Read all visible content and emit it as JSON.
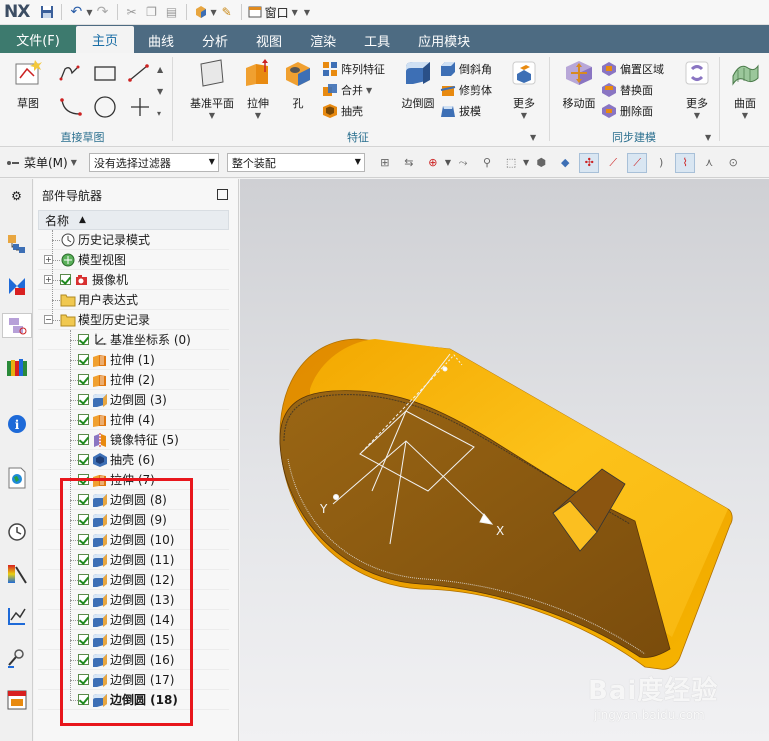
{
  "app": {
    "logo": "NX",
    "window_menu": "窗口"
  },
  "ribbon_tabs": {
    "file": "文件(F)",
    "items": [
      "主页",
      "曲线",
      "分析",
      "视图",
      "渲染",
      "工具",
      "应用模块"
    ]
  },
  "ribbon": {
    "sketch": {
      "label": "草图",
      "group": "直接草图"
    },
    "feature": {
      "group": "特征",
      "datum_plane": "基准平面",
      "extrude": "拉伸",
      "hole": "孔",
      "pattern": "阵列特征",
      "unite": "合并",
      "shell": "抽壳",
      "edge_blend": "边倒圆",
      "chamfer": "倒斜角",
      "trim_body": "修剪体",
      "draft": "拔模",
      "more": "更多"
    },
    "sync": {
      "group": "同步建模",
      "move_face": "移动面",
      "offset_region": "偏置区域",
      "replace_face": "替换面",
      "delete_face": "删除面",
      "more": "更多"
    },
    "surface": {
      "label": "曲面"
    }
  },
  "cmdbar": {
    "menu": "菜单(M)",
    "filter": "没有选择过滤器",
    "assembly": "整个装配"
  },
  "navigator": {
    "title": "部件导航器",
    "column": "名称",
    "items": [
      {
        "label": "历史记录模式",
        "level": 0,
        "icon": "clock-icon",
        "expander": false,
        "check": false
      },
      {
        "label": "模型视图",
        "level": 0,
        "icon": "model-view-icon",
        "expander": true,
        "check": false
      },
      {
        "label": "摄像机",
        "level": 0,
        "icon": "camera-icon",
        "expander": true,
        "check": true
      },
      {
        "label": "用户表达式",
        "level": 0,
        "icon": "folder-icon",
        "expander": false,
        "check": false
      },
      {
        "label": "模型历史记录",
        "level": 0,
        "icon": "folder-icon",
        "expander": "minus",
        "check": false
      },
      {
        "label": "基准坐标系 (0)",
        "level": 1,
        "icon": "datum-csys-icon",
        "check": true
      },
      {
        "label": "拉伸 (1)",
        "level": 1,
        "icon": "extrude-icon",
        "check": true
      },
      {
        "label": "拉伸 (2)",
        "level": 1,
        "icon": "extrude-icon",
        "check": true
      },
      {
        "label": "边倒圆 (3)",
        "level": 1,
        "icon": "edge-blend-icon",
        "check": true
      },
      {
        "label": "拉伸 (4)",
        "level": 1,
        "icon": "extrude-icon",
        "check": true
      },
      {
        "label": "镜像特征 (5)",
        "level": 1,
        "icon": "mirror-feature-icon",
        "check": true
      },
      {
        "label": "抽壳 (6)",
        "level": 1,
        "icon": "shell-icon",
        "check": true
      },
      {
        "label": "拉伸 (7)",
        "level": 1,
        "icon": "extrude-icon",
        "check": true
      },
      {
        "label": "边倒圆 (8)",
        "level": 1,
        "icon": "edge-blend-icon",
        "check": true
      },
      {
        "label": "边倒圆 (9)",
        "level": 1,
        "icon": "edge-blend-icon",
        "check": true
      },
      {
        "label": "边倒圆 (10)",
        "level": 1,
        "icon": "edge-blend-icon",
        "check": true
      },
      {
        "label": "边倒圆 (11)",
        "level": 1,
        "icon": "edge-blend-icon",
        "check": true
      },
      {
        "label": "边倒圆 (12)",
        "level": 1,
        "icon": "edge-blend-icon",
        "check": true
      },
      {
        "label": "边倒圆 (13)",
        "level": 1,
        "icon": "edge-blend-icon",
        "check": true
      },
      {
        "label": "边倒圆 (14)",
        "level": 1,
        "icon": "edge-blend-icon",
        "check": true
      },
      {
        "label": "边倒圆 (15)",
        "level": 1,
        "icon": "edge-blend-icon",
        "check": true
      },
      {
        "label": "边倒圆 (16)",
        "level": 1,
        "icon": "edge-blend-icon",
        "check": true
      },
      {
        "label": "边倒圆 (17)",
        "level": 1,
        "icon": "edge-blend-icon",
        "check": true
      },
      {
        "label": "边倒圆 (18)",
        "level": 1,
        "icon": "edge-blend-icon",
        "check": true,
        "bold": true
      }
    ]
  },
  "viewport": {
    "axis_x": "X",
    "axis_y": "Y"
  },
  "watermark": {
    "brand": "Bai度经验",
    "url": "jingyan.baidu.com"
  },
  "colors": {
    "tab_bar": "#4d6b82",
    "file_tab": "#3d7a6e",
    "model_top": "#f7b500",
    "model_inner": "#8a5a10",
    "highlight": "#e8161c"
  }
}
